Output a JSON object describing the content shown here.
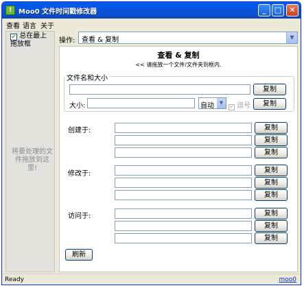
{
  "window": {
    "title": "Moo0 文件时间戳修改器",
    "min_glyph": "_",
    "max_glyph": "□",
    "close_glyph": "✕"
  },
  "menu": [
    "查看",
    "语言",
    "关于"
  ],
  "left_panel": {
    "always_on_top": "总在最上",
    "drop_box": "拖放框",
    "drop_hint": "将要处理的文件拖放到这里!"
  },
  "operation": {
    "label": "操作:",
    "selected": "查看 & 复制"
  },
  "main": {
    "heading": "查看 & 复制",
    "subheading": "<< 请拖放一个文件/文件夹到框内.",
    "group_title": "文件名和大小",
    "size_label": "大小:",
    "size_unit": "自动",
    "comma_label": "逗号",
    "copy_label": "复制",
    "created_label": "创建于:",
    "modified_label": "修改于:",
    "accessed_label": "访问于:",
    "refresh_label": "刷新"
  },
  "status": {
    "text": "Ready",
    "link": "moo0"
  }
}
